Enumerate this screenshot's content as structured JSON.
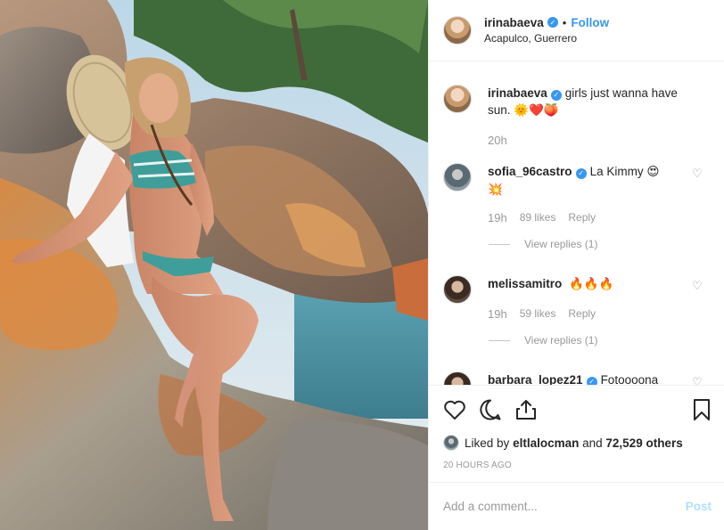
{
  "post": {
    "author": "irinabaeva",
    "follow_label": "Follow",
    "separator": "•",
    "location": "Acapulco, Guerrero"
  },
  "caption": {
    "username": "irinabaeva",
    "text": "girls just wanna have sun.",
    "emojis": "🌞❤️🍑",
    "time": "20h"
  },
  "comments": [
    {
      "username": "sofia_96castro",
      "text": "La Kimmy",
      "emojis": "😍",
      "emojis2": "💥",
      "time": "19h",
      "likes": "89 likes",
      "reply_label": "Reply",
      "view_replies": "View replies (1)"
    },
    {
      "username": "melissamitro",
      "text": "",
      "emojis": "🔥🔥🔥",
      "time": "19h",
      "likes": "59 likes",
      "reply_label": "Reply",
      "view_replies": "View replies (1)"
    },
    {
      "username": "barbara_lopez21",
      "text": "Fotoooona"
    }
  ],
  "likes_line": {
    "prefix": "Liked by",
    "user": "eltlalocman",
    "and": "and",
    "count": "72,529 others"
  },
  "timestamp": "20 HOURS AGO",
  "add_comment": {
    "placeholder": "Add a comment...",
    "post_label": "Post"
  },
  "colors": {
    "accent": "#3897f0",
    "post_disabled": "#b2dffc",
    "muted": "#999999"
  }
}
